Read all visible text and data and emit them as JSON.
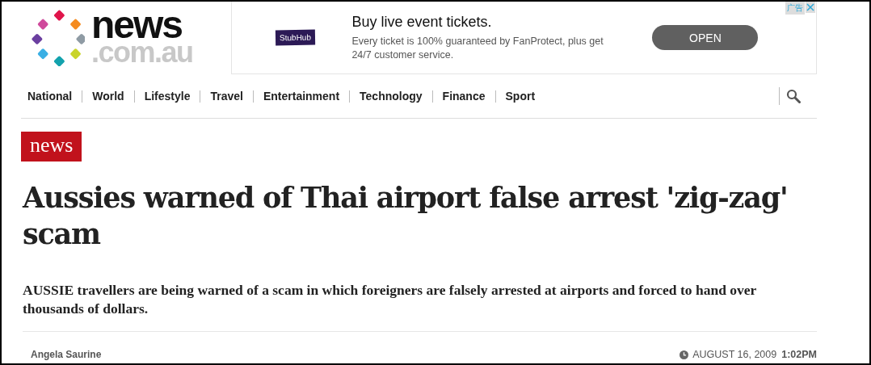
{
  "logo": {
    "word": "news",
    "domain": ".com.au"
  },
  "ad": {
    "label": "广告",
    "brand": "StubHub",
    "title": "Buy live event tickets.",
    "text": "Every ticket is 100% guaranteed by FanProtect, plus get 24/7 customer service.",
    "button": "OPEN"
  },
  "nav": {
    "items": [
      "National",
      "World",
      "Lifestyle",
      "Travel",
      "Entertainment",
      "Technology",
      "Finance",
      "Sport"
    ]
  },
  "section_badge": "news",
  "article": {
    "headline": "Aussies warned of Thai airport false arrest 'zig-zag' scam",
    "standfirst": "AUSSIE travellers are being warned of a scam in which foreigners are falsely arrested at airports and forced to hand over thousands of dollars.",
    "author": "Angela Saurine",
    "date": "AUGUST 16, 2009",
    "time": "1:02PM"
  }
}
